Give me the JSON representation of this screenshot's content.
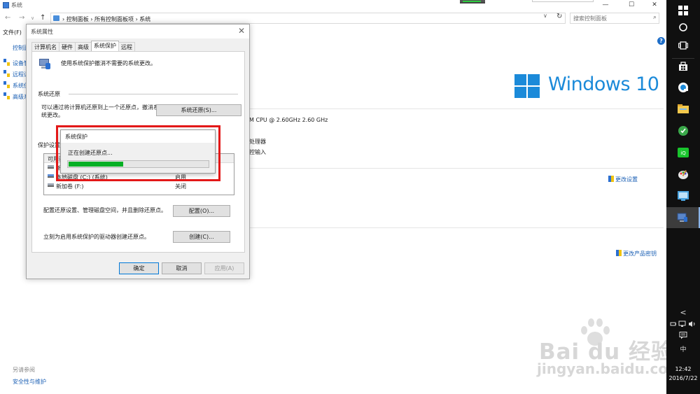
{
  "window": {
    "title": "系统",
    "minimize": "—",
    "maximize": "☐",
    "close": "✕"
  },
  "address": {
    "back": "←",
    "forward": "→",
    "dropdown": "∨",
    "up": "↑",
    "crumbs": "› 控制面板 › 所有控制面板项 › 系统",
    "search_placeholder": "搜索控制面板",
    "refresh": "↻"
  },
  "menubar": {
    "file": "文件(F)"
  },
  "left_links": [
    {
      "label": "控制面"
    },
    {
      "label": "设备管"
    },
    {
      "label": "远程设"
    },
    {
      "label": "系统保"
    },
    {
      "label": "高级系"
    }
  ],
  "see_also": {
    "title": "另请参阅",
    "link": "安全性与维护"
  },
  "system_info": {
    "brand": "Windows 10",
    "cpu": "M CPU @ 2.60GHz   2.60 GHz",
    "system_type": "处理器",
    "pen_touch": "控输入",
    "change_settings": "更改设置",
    "change_product_key": "更改产品密钥"
  },
  "dialog": {
    "title": "系统属性",
    "close": "✕",
    "tabs": [
      "计算机名",
      "硬件",
      "高级",
      "系统保护",
      "远程"
    ],
    "active_tab": "系统保护",
    "intro": "使用系统保护撤消不需要的系统更改。",
    "restore_group": "系统还原",
    "restore_desc_1": "可以通过将计算机还原到上一个还原点，撤消系",
    "restore_desc_2": "统更改。",
    "restore_button": "系统还原(S)...",
    "protection_group": "保护设置",
    "list_header": "可用驱",
    "drives": [
      {
        "name": "新加",
        "state": ""
      },
      {
        "name": "本地磁盘 (C:) (系统)",
        "state": "启用"
      },
      {
        "name": "新加卷 (F:)",
        "state": "关闭"
      }
    ],
    "configure_desc": "配置还原设置、管理磁盘空间，并且删除还原点。",
    "configure_button": "配置(O)...",
    "create_desc": "立刻为启用系统保护的驱动器创建还原点。",
    "create_button": "创建(C)...",
    "ok": "确定",
    "cancel": "取消",
    "apply": "应用(A)"
  },
  "popup": {
    "title": "系统保护",
    "message": "正在创建还原点...",
    "progress": 0.39
  },
  "taskbar": {
    "icons": [
      "windows-start-icon",
      "cortana-icon",
      "task-view-icon",
      "store-icon",
      "browser-icon",
      "file-explorer-icon",
      "app-green-icon",
      "app-iqiyi-icon",
      "paint-icon",
      "app-blue-icon",
      "control-panel-icon"
    ],
    "tray_chevron": "<",
    "ime": "中",
    "time": "12:42",
    "date": "2016/7/22"
  },
  "watermark": {
    "main": "Bai du 经验",
    "sub": "jingyan.baidu.com"
  }
}
